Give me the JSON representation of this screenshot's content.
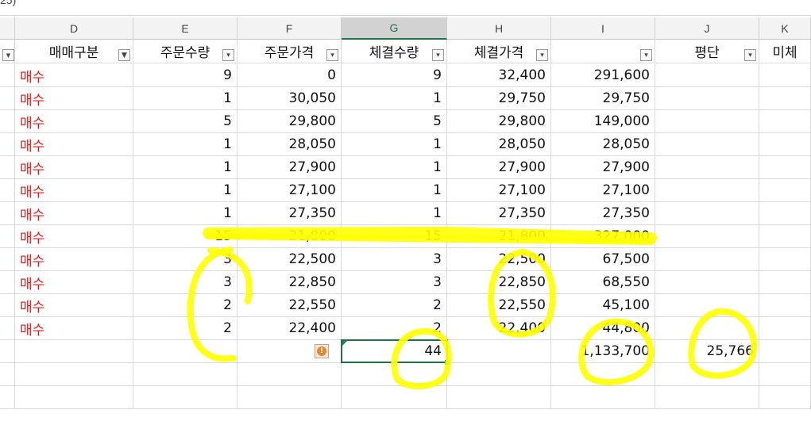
{
  "formula_fragment": "25)",
  "columns": [
    {
      "letter": "D",
      "header": "매매구분",
      "filter": "sort"
    },
    {
      "letter": "E",
      "header": "주문수량",
      "filter": "dropdown"
    },
    {
      "letter": "F",
      "header": "주문가격",
      "filter": "dropdown"
    },
    {
      "letter": "G",
      "header": "체결수량",
      "filter": "dropdown"
    },
    {
      "letter": "H",
      "header": "체결가격",
      "filter": "dropdown"
    },
    {
      "letter": "I",
      "header": "",
      "filter": "dropdown"
    },
    {
      "letter": "J",
      "header": "평단",
      "filter": "dropdown"
    },
    {
      "letter": "K",
      "header": "미체",
      "filter": ""
    }
  ],
  "rows": [
    [
      "매수",
      "9",
      "0",
      "9",
      "32,400",
      "291,600"
    ],
    [
      "매수",
      "1",
      "30,050",
      "1",
      "29,750",
      "29,750"
    ],
    [
      "매수",
      "5",
      "29,800",
      "5",
      "29,800",
      "149,000"
    ],
    [
      "매수",
      "1",
      "28,050",
      "1",
      "28,050",
      "28,050"
    ],
    [
      "매수",
      "1",
      "27,900",
      "1",
      "27,900",
      "27,900"
    ],
    [
      "매수",
      "1",
      "27,100",
      "1",
      "27,100",
      "27,100"
    ],
    [
      "매수",
      "1",
      "27,350",
      "1",
      "27,350",
      "27,350"
    ],
    [
      "매수",
      "15",
      "21,800",
      "15",
      "21,800",
      "327,000"
    ],
    [
      "매수",
      "3",
      "22,500",
      "3",
      "22,500",
      "67,500"
    ],
    [
      "매수",
      "3",
      "22,850",
      "3",
      "22,850",
      "68,550"
    ],
    [
      "매수",
      "2",
      "22,550",
      "2",
      "22,550",
      "45,100"
    ],
    [
      "매수",
      "2",
      "22,400",
      "2",
      "22,400",
      "44,800"
    ]
  ],
  "totals": {
    "quantity": "44",
    "amount": "1,133,700",
    "average": "25,766"
  },
  "selected_column": "G",
  "colors": {
    "highlight": "#ffff00",
    "sell_buy_text": "#d11f1f",
    "selection": "#217346"
  }
}
